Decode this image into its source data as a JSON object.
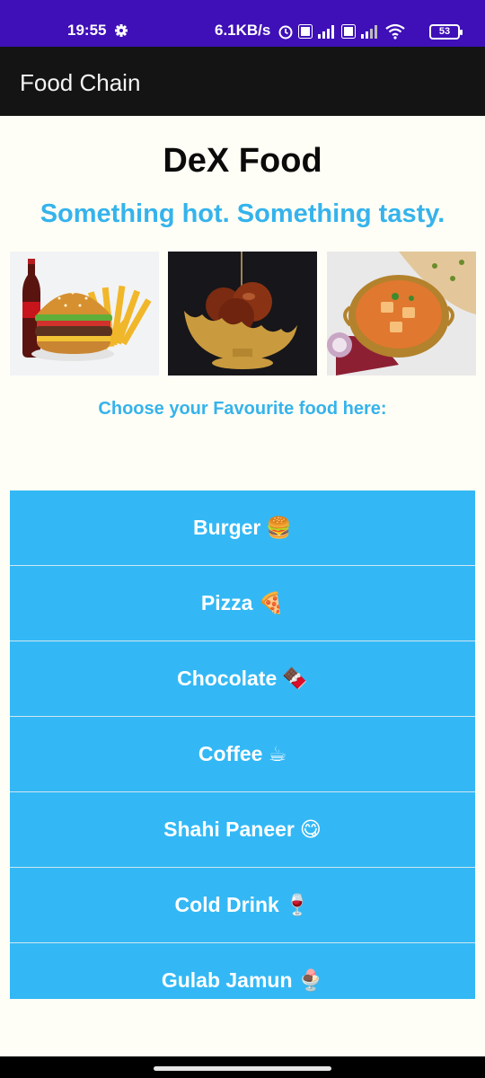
{
  "status_bar": {
    "time": "19:55",
    "network_speed": "6.1KB/s",
    "battery_level": "53",
    "icons": [
      "settings-gear-icon",
      "alarm-icon",
      "volte-icon",
      "signal-icon",
      "volte-icon",
      "signal-icon",
      "wifi-icon",
      "battery-icon"
    ]
  },
  "app_bar": {
    "title": "Food Chain"
  },
  "header": {
    "title": "DeX Food",
    "subtitle": "Something hot. Something tasty."
  },
  "photos": [
    {
      "name": "burger-coke-fries"
    },
    {
      "name": "gulab-jamun-bowl"
    },
    {
      "name": "paneer-curry-naan"
    }
  ],
  "prompt": "Choose your Favourite food here:",
  "food_items": [
    {
      "label": "Burger",
      "emoji": "🍔"
    },
    {
      "label": "Pizza",
      "emoji": "🍕"
    },
    {
      "label": "Chocolate",
      "emoji": "🍫"
    },
    {
      "label": "Coffee",
      "emoji": "☕"
    },
    {
      "label": "Shahi Paneer",
      "emoji": "😋"
    },
    {
      "label": "Cold Drink",
      "emoji": "🍷"
    },
    {
      "label": "Gulab Jamun",
      "emoji": "🍨"
    }
  ],
  "colors": {
    "status_bar": "#3f10b8",
    "app_bar": "#141414",
    "accent": "#35b3ec",
    "list_background": "#33b8f5",
    "page_background": "#fffef6"
  }
}
